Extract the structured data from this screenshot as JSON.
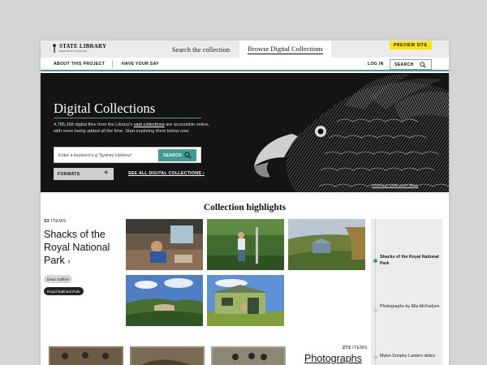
{
  "header": {
    "logo_main": "STATE LIBRARY",
    "logo_sub": "NEW SOUTH WALES",
    "tabs": [
      "Search the collection",
      "Browse Digital Collections"
    ],
    "preview_badge": "PREVIEW SITE"
  },
  "nav": {
    "about": "ABOUT THIS PROJECT",
    "have_your_say": "HAVE YOUR SAY",
    "login": "LOG IN",
    "search": "SEARCH"
  },
  "hero": {
    "title": "Digital Collections",
    "desc_before": "4,785,368 digital files from the Library's ",
    "desc_link": "vast collections",
    "desc_after": " are accessible online, with more being added all the time. Start exploring them below now.",
    "search_placeholder": "Enter a keyword e.g 'Sydney Harbour'",
    "search_button": "SEARCH",
    "formats": "FORMATS",
    "see_all": "SEE ALL DIGITAL COLLECTIONS",
    "photo_credit": "Detail from Sarah Stone album"
  },
  "highlights": {
    "title": "Collection highlights",
    "count": "33",
    "count_label": "ITEMS",
    "collection_title": "Shacks of the Royal National Park",
    "tags": [
      "Dean Saffron",
      "Royal National Park"
    ],
    "side_items": [
      "Shacks of the Royal National Park",
      "Photographs by Ella McFadyen",
      "Myles Dunphy Lantern slides"
    ],
    "second_count": "272",
    "second_count_label": "ITEMS",
    "second_title": "Photographs"
  },
  "colors": {
    "accent": "#3f9e8f",
    "badge": "#ffe500",
    "hero_bg": "#141414"
  }
}
